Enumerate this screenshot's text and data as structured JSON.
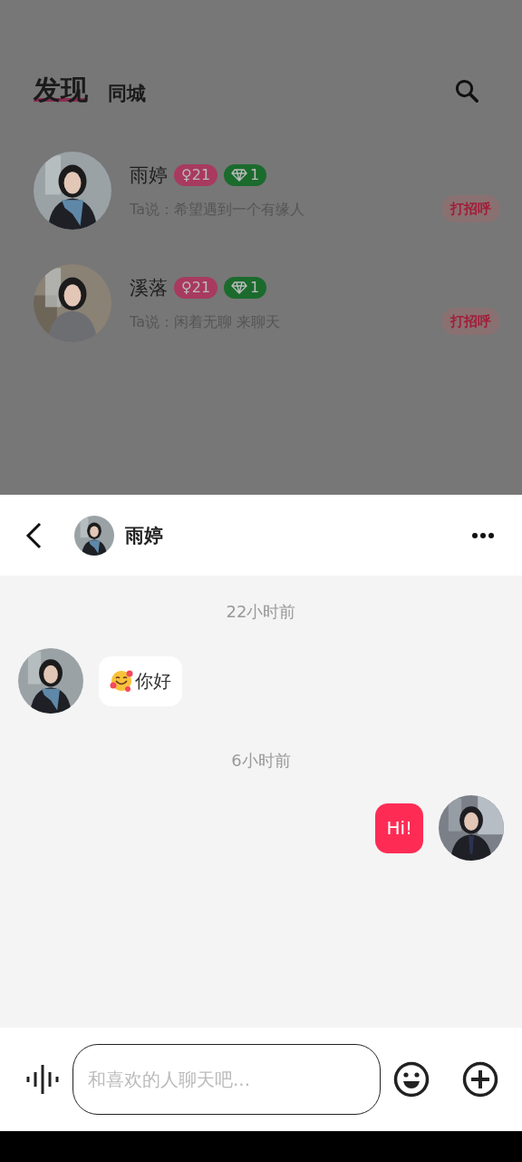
{
  "tabs": [
    {
      "label": "发现",
      "selected": true
    },
    {
      "label": "同城",
      "selected": false
    }
  ],
  "users": [
    {
      "name": "雨婷",
      "age": "♀21",
      "level": "1",
      "quote": "Ta说：希望遇到一个有缘人",
      "action": "打招呼"
    },
    {
      "name": "溪落",
      "age": "♀21",
      "level": "1",
      "quote": "Ta说：闲着无聊 来聊天",
      "action": "打招呼"
    }
  ],
  "chat": {
    "title": "雨婷",
    "messages": [
      {
        "kind": "time",
        "text": "22小时前"
      },
      {
        "kind": "incoming",
        "text": "你好"
      },
      {
        "kind": "time",
        "text": "6小时前"
      },
      {
        "kind": "outgoing",
        "text": "Hi!"
      }
    ]
  },
  "composer": {
    "placeholder": "和喜欢的人聊天吧..."
  }
}
